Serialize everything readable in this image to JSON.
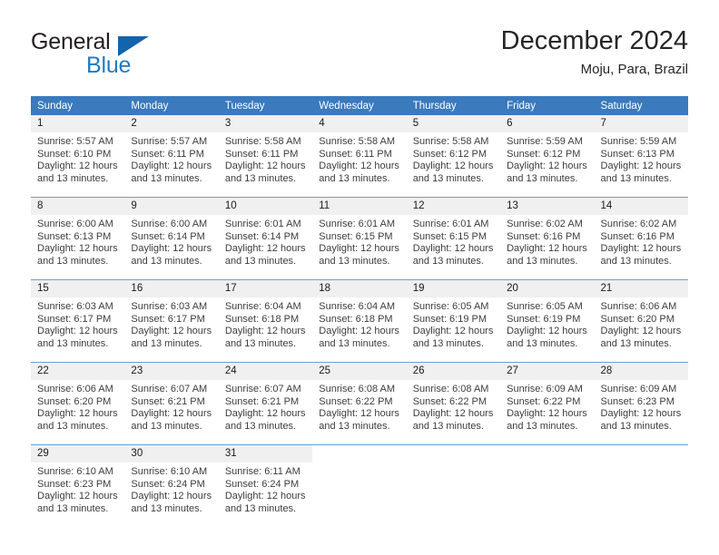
{
  "brand": {
    "name_part1": "General",
    "name_part2": "Blue",
    "triangle_color": "#1463ad",
    "blue_color": "#1f7ac4"
  },
  "header": {
    "title": "December 2024",
    "subtitle": "Moju, Para, Brazil"
  },
  "theme": {
    "header_row_bg": "#3a7abd",
    "header_row_text": "#ffffff",
    "daynum_bg": "#f0f0f0",
    "row_divider": "#6a9fd4"
  },
  "weekdays": [
    "Sunday",
    "Monday",
    "Tuesday",
    "Wednesday",
    "Thursday",
    "Friday",
    "Saturday"
  ],
  "labels": {
    "sunrise_prefix": "Sunrise:",
    "sunset_prefix": "Sunset:",
    "daylight_prefix": "Daylight:"
  },
  "weeks": [
    [
      {
        "day": "1",
        "sunrise": "Sunrise: 5:57 AM",
        "sunset": "Sunset: 6:10 PM",
        "daylight_line1": "Daylight: 12 hours",
        "daylight_line2": "and 13 minutes."
      },
      {
        "day": "2",
        "sunrise": "Sunrise: 5:57 AM",
        "sunset": "Sunset: 6:11 PM",
        "daylight_line1": "Daylight: 12 hours",
        "daylight_line2": "and 13 minutes."
      },
      {
        "day": "3",
        "sunrise": "Sunrise: 5:58 AM",
        "sunset": "Sunset: 6:11 PM",
        "daylight_line1": "Daylight: 12 hours",
        "daylight_line2": "and 13 minutes."
      },
      {
        "day": "4",
        "sunrise": "Sunrise: 5:58 AM",
        "sunset": "Sunset: 6:11 PM",
        "daylight_line1": "Daylight: 12 hours",
        "daylight_line2": "and 13 minutes."
      },
      {
        "day": "5",
        "sunrise": "Sunrise: 5:58 AM",
        "sunset": "Sunset: 6:12 PM",
        "daylight_line1": "Daylight: 12 hours",
        "daylight_line2": "and 13 minutes."
      },
      {
        "day": "6",
        "sunrise": "Sunrise: 5:59 AM",
        "sunset": "Sunset: 6:12 PM",
        "daylight_line1": "Daylight: 12 hours",
        "daylight_line2": "and 13 minutes."
      },
      {
        "day": "7",
        "sunrise": "Sunrise: 5:59 AM",
        "sunset": "Sunset: 6:13 PM",
        "daylight_line1": "Daylight: 12 hours",
        "daylight_line2": "and 13 minutes."
      }
    ],
    [
      {
        "day": "8",
        "sunrise": "Sunrise: 6:00 AM",
        "sunset": "Sunset: 6:13 PM",
        "daylight_line1": "Daylight: 12 hours",
        "daylight_line2": "and 13 minutes."
      },
      {
        "day": "9",
        "sunrise": "Sunrise: 6:00 AM",
        "sunset": "Sunset: 6:14 PM",
        "daylight_line1": "Daylight: 12 hours",
        "daylight_line2": "and 13 minutes."
      },
      {
        "day": "10",
        "sunrise": "Sunrise: 6:01 AM",
        "sunset": "Sunset: 6:14 PM",
        "daylight_line1": "Daylight: 12 hours",
        "daylight_line2": "and 13 minutes."
      },
      {
        "day": "11",
        "sunrise": "Sunrise: 6:01 AM",
        "sunset": "Sunset: 6:15 PM",
        "daylight_line1": "Daylight: 12 hours",
        "daylight_line2": "and 13 minutes."
      },
      {
        "day": "12",
        "sunrise": "Sunrise: 6:01 AM",
        "sunset": "Sunset: 6:15 PM",
        "daylight_line1": "Daylight: 12 hours",
        "daylight_line2": "and 13 minutes."
      },
      {
        "day": "13",
        "sunrise": "Sunrise: 6:02 AM",
        "sunset": "Sunset: 6:16 PM",
        "daylight_line1": "Daylight: 12 hours",
        "daylight_line2": "and 13 minutes."
      },
      {
        "day": "14",
        "sunrise": "Sunrise: 6:02 AM",
        "sunset": "Sunset: 6:16 PM",
        "daylight_line1": "Daylight: 12 hours",
        "daylight_line2": "and 13 minutes."
      }
    ],
    [
      {
        "day": "15",
        "sunrise": "Sunrise: 6:03 AM",
        "sunset": "Sunset: 6:17 PM",
        "daylight_line1": "Daylight: 12 hours",
        "daylight_line2": "and 13 minutes."
      },
      {
        "day": "16",
        "sunrise": "Sunrise: 6:03 AM",
        "sunset": "Sunset: 6:17 PM",
        "daylight_line1": "Daylight: 12 hours",
        "daylight_line2": "and 13 minutes."
      },
      {
        "day": "17",
        "sunrise": "Sunrise: 6:04 AM",
        "sunset": "Sunset: 6:18 PM",
        "daylight_line1": "Daylight: 12 hours",
        "daylight_line2": "and 13 minutes."
      },
      {
        "day": "18",
        "sunrise": "Sunrise: 6:04 AM",
        "sunset": "Sunset: 6:18 PM",
        "daylight_line1": "Daylight: 12 hours",
        "daylight_line2": "and 13 minutes."
      },
      {
        "day": "19",
        "sunrise": "Sunrise: 6:05 AM",
        "sunset": "Sunset: 6:19 PM",
        "daylight_line1": "Daylight: 12 hours",
        "daylight_line2": "and 13 minutes."
      },
      {
        "day": "20",
        "sunrise": "Sunrise: 6:05 AM",
        "sunset": "Sunset: 6:19 PM",
        "daylight_line1": "Daylight: 12 hours",
        "daylight_line2": "and 13 minutes."
      },
      {
        "day": "21",
        "sunrise": "Sunrise: 6:06 AM",
        "sunset": "Sunset: 6:20 PM",
        "daylight_line1": "Daylight: 12 hours",
        "daylight_line2": "and 13 minutes."
      }
    ],
    [
      {
        "day": "22",
        "sunrise": "Sunrise: 6:06 AM",
        "sunset": "Sunset: 6:20 PM",
        "daylight_line1": "Daylight: 12 hours",
        "daylight_line2": "and 13 minutes."
      },
      {
        "day": "23",
        "sunrise": "Sunrise: 6:07 AM",
        "sunset": "Sunset: 6:21 PM",
        "daylight_line1": "Daylight: 12 hours",
        "daylight_line2": "and 13 minutes."
      },
      {
        "day": "24",
        "sunrise": "Sunrise: 6:07 AM",
        "sunset": "Sunset: 6:21 PM",
        "daylight_line1": "Daylight: 12 hours",
        "daylight_line2": "and 13 minutes."
      },
      {
        "day": "25",
        "sunrise": "Sunrise: 6:08 AM",
        "sunset": "Sunset: 6:22 PM",
        "daylight_line1": "Daylight: 12 hours",
        "daylight_line2": "and 13 minutes."
      },
      {
        "day": "26",
        "sunrise": "Sunrise: 6:08 AM",
        "sunset": "Sunset: 6:22 PM",
        "daylight_line1": "Daylight: 12 hours",
        "daylight_line2": "and 13 minutes."
      },
      {
        "day": "27",
        "sunrise": "Sunrise: 6:09 AM",
        "sunset": "Sunset: 6:22 PM",
        "daylight_line1": "Daylight: 12 hours",
        "daylight_line2": "and 13 minutes."
      },
      {
        "day": "28",
        "sunrise": "Sunrise: 6:09 AM",
        "sunset": "Sunset: 6:23 PM",
        "daylight_line1": "Daylight: 12 hours",
        "daylight_line2": "and 13 minutes."
      }
    ],
    [
      {
        "day": "29",
        "sunrise": "Sunrise: 6:10 AM",
        "sunset": "Sunset: 6:23 PM",
        "daylight_line1": "Daylight: 12 hours",
        "daylight_line2": "and 13 minutes."
      },
      {
        "day": "30",
        "sunrise": "Sunrise: 6:10 AM",
        "sunset": "Sunset: 6:24 PM",
        "daylight_line1": "Daylight: 12 hours",
        "daylight_line2": "and 13 minutes."
      },
      {
        "day": "31",
        "sunrise": "Sunrise: 6:11 AM",
        "sunset": "Sunset: 6:24 PM",
        "daylight_line1": "Daylight: 12 hours",
        "daylight_line2": "and 13 minutes."
      },
      {
        "day": "",
        "sunrise": "",
        "sunset": "",
        "daylight_line1": "",
        "daylight_line2": ""
      },
      {
        "day": "",
        "sunrise": "",
        "sunset": "",
        "daylight_line1": "",
        "daylight_line2": ""
      },
      {
        "day": "",
        "sunrise": "",
        "sunset": "",
        "daylight_line1": "",
        "daylight_line2": ""
      },
      {
        "day": "",
        "sunrise": "",
        "sunset": "",
        "daylight_line1": "",
        "daylight_line2": ""
      }
    ]
  ]
}
